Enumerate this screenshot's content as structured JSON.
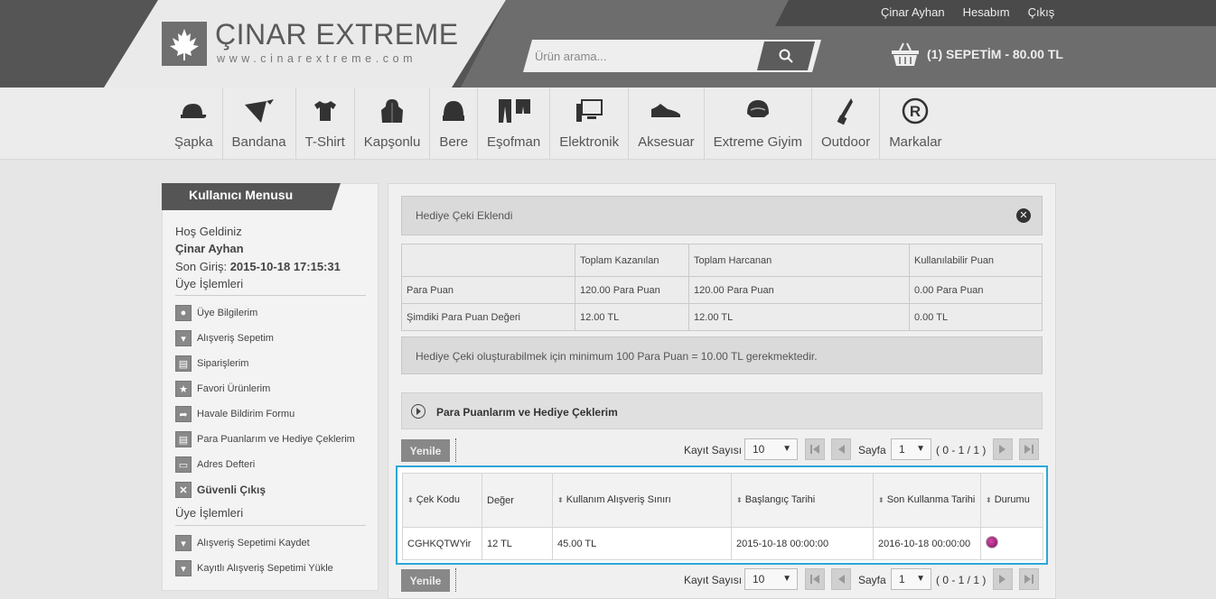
{
  "header": {
    "logo_name": "ÇINAR EXTREME",
    "logo_url": "www.cinarextreme.com",
    "top_links": [
      "Çinar Ayhan",
      "Hesabım",
      "Çıkış"
    ],
    "search_placeholder": "Ürün arama...",
    "cart_text": "(1) SEPETİM - 80.00 TL"
  },
  "nav": [
    {
      "label": "Şapka",
      "icon": "cap-icon"
    },
    {
      "label": "Bandana",
      "icon": "bandana-icon"
    },
    {
      "label": "T-Shirt",
      "icon": "tshirt-icon"
    },
    {
      "label": "Kapşonlu",
      "icon": "hoodie-icon"
    },
    {
      "label": "Bere",
      "icon": "beanie-icon"
    },
    {
      "label": "Eşofman",
      "icon": "tracksuit-icon"
    },
    {
      "label": "Elektronik",
      "icon": "computer-icon"
    },
    {
      "label": "Aksesuar",
      "icon": "shoe-icon"
    },
    {
      "label": "Extreme Giyim",
      "icon": "helmet-icon"
    },
    {
      "label": "Outdoor",
      "icon": "knife-icon"
    },
    {
      "label": "Markalar",
      "icon": "registered-icon"
    }
  ],
  "sidebar": {
    "title": "Kullanıcı Menusu",
    "welcome": "Hoş Geldiniz",
    "user": "Çinar Ayhan",
    "last_login_label": "Son Giriş:",
    "last_login": "2015-10-18 17:15:31",
    "section1": "Üye İşlemleri",
    "items": [
      "Üye Bilgilerim",
      "Alışveriş Sepetim",
      "Siparişlerim",
      "Favori Ürünlerim",
      "Havale Bildirim Formu",
      "Para Puanlarım ve Hediye Çeklerim",
      "Adres Defteri",
      "Güvenli Çıkış"
    ],
    "section2": "Üye İşlemleri",
    "items2": [
      "Alışveriş Sepetimi Kaydet",
      "Kayıtlı Alışveriş Sepetimi Yükle"
    ]
  },
  "alert": "Hediye Çeki Eklendi",
  "points": {
    "headers": [
      "",
      "Toplam Kazanılan",
      "Toplam Harcanan",
      "Kullanılabilir Puan"
    ],
    "rows": [
      [
        "Para Puan",
        "120.00 Para Puan",
        "120.00 Para Puan",
        "0.00 Para Puan"
      ],
      [
        "Şimdiki Para Puan Değeri",
        "12.00 TL",
        "12.00 TL",
        "0.00 TL"
      ]
    ]
  },
  "info": "Hediye Çeki oluşturabilmek için minimum 100 Para Puan = 10.00 TL gerekmektedir.",
  "accordion": "Para Puanlarım ve Hediye Çeklerim",
  "pager": {
    "refresh": "Yenile",
    "count_label": "Kayıt Sayısı",
    "count": "10",
    "page_label": "Sayfa",
    "page": "1",
    "range": "( 0 - 1 / 1 )"
  },
  "grid": {
    "headers": [
      "Çek Kodu",
      "Değer",
      "Kullanım Alışveriş Sınırı",
      "Başlangıç Tarihi",
      "Son Kullanma Tarihi",
      "Durumu"
    ],
    "rows": [
      [
        "CGHKQTWYir",
        "12 TL",
        "45.00 TL",
        "2015-10-18 00:00:00",
        "2016-10-18 00:00:00",
        ""
      ]
    ]
  }
}
